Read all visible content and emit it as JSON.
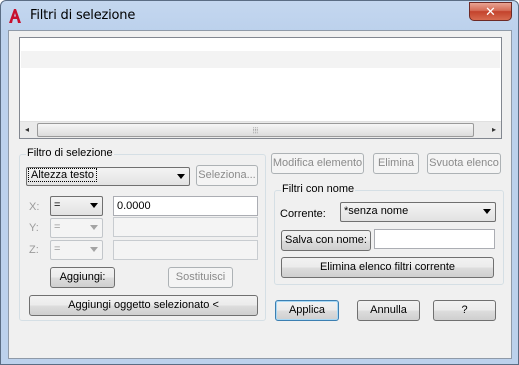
{
  "window": {
    "title": "Filtri di selezione",
    "close_glyph": "✕"
  },
  "list": {
    "scroll_grip": "⦙⦙⦙",
    "left_arrow": "◂",
    "right_arrow": "▸"
  },
  "filter_group": {
    "label": "Filtro di selezione",
    "type_value": "Altezza testo",
    "select_button": "Seleziona...",
    "x_label": "X:",
    "y_label": "Y:",
    "z_label": "Z:",
    "x_operator": "=",
    "y_operator": "=",
    "z_operator": "=",
    "x_value": "0.0000",
    "y_value": "",
    "z_value": "",
    "add_button": "Aggiungi:",
    "replace_button": "Sostituisci",
    "add_selected_button": "Aggiungi oggetto selezionato <"
  },
  "edit_buttons": {
    "edit_item": "Modifica elemento",
    "delete": "Elimina",
    "clear_list": "Svuota elenco"
  },
  "named_filters": {
    "label": "Filtri con nome",
    "current_label": "Corrente:",
    "current_value": "*senza nome",
    "save_as": "Salva con nome:",
    "save_as_value": "",
    "delete_current": "Elimina elenco filtri corrente"
  },
  "footer": {
    "apply": "Applica",
    "cancel": "Annulla",
    "help": "?"
  }
}
